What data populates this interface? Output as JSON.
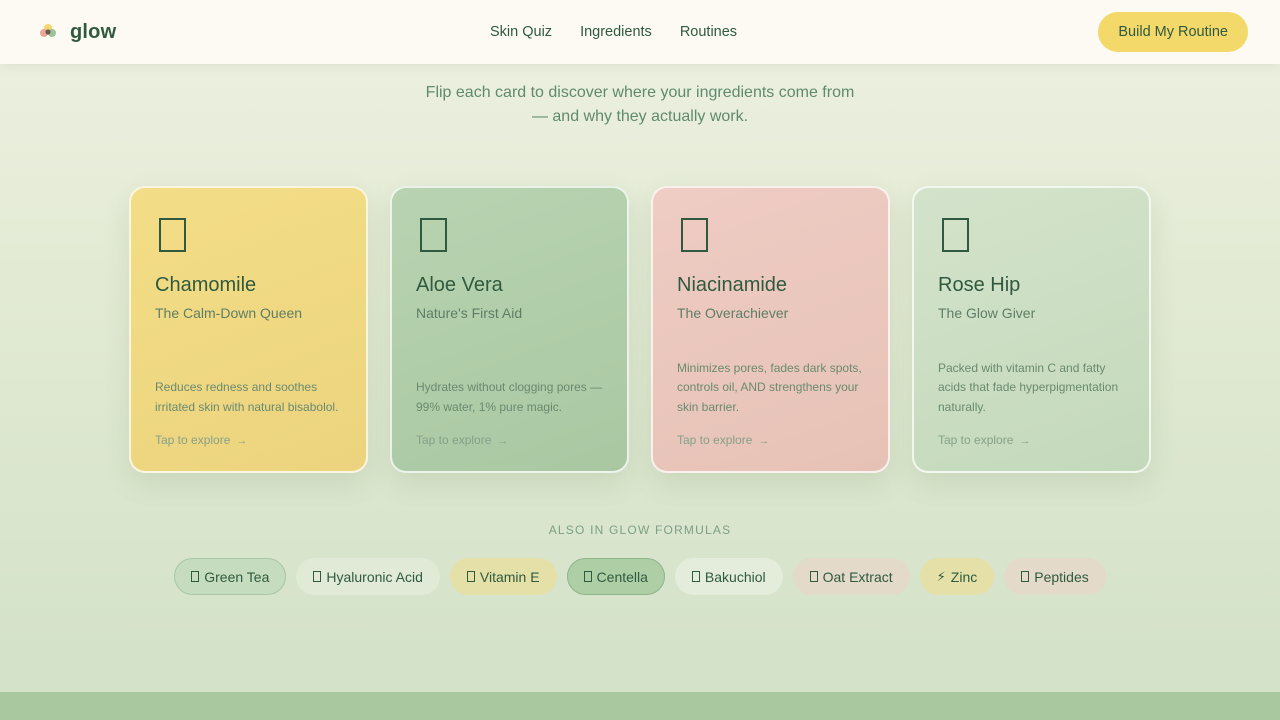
{
  "header": {
    "brand": "glow",
    "nav": [
      "Skin Quiz",
      "Ingredients",
      "Routines"
    ],
    "cta_label": "Build My Routine"
  },
  "intro": {
    "line1": "Flip each card to discover where your ingredients come from",
    "line2": "— and why they actually work."
  },
  "cards": [
    {
      "title": "Chamomile",
      "subtitle": "The Calm-Down Queen",
      "description": "Reduces redness and soothes irritated skin with natural bisabolol.",
      "tap": "Tap to explore",
      "color": "#f3dd86"
    },
    {
      "title": "Aloe Vera",
      "subtitle": "Nature's First Aid",
      "description": "Hydrates without clogging pores — 99% water, 1% pure magic.",
      "tap": "Tap to explore",
      "color": "#b8d3b1"
    },
    {
      "title": "Niacinamide",
      "subtitle": "The Overachiever",
      "description": "Minimizes pores, fades dark spots, controls oil, AND strengthens your skin barrier.",
      "tap": "Tap to explore",
      "color": "#efccc4"
    },
    {
      "title": "Rose Hip",
      "subtitle": "The Glow Giver",
      "description": "Packed with vitamin C and fatty acids that fade hyperpigmentation naturally.",
      "tap": "Tap to explore",
      "color": "#d3e3cb"
    }
  ],
  "also": {
    "heading": "ALSO IN GLOW FORMULAS",
    "chips": [
      {
        "label": "Green Tea",
        "icon": "leaf-icon"
      },
      {
        "label": "Hyaluronic Acid",
        "icon": "droplet-icon"
      },
      {
        "label": "Vitamin E",
        "icon": "capsule-icon"
      },
      {
        "label": "Centella",
        "icon": "herb-icon",
        "selected": true
      },
      {
        "label": "Bakuchiol",
        "icon": "plant-icon"
      },
      {
        "label": "Oat Extract",
        "icon": "grain-icon"
      },
      {
        "label": "Zinc",
        "icon": "lightning-icon"
      },
      {
        "label": "Peptides",
        "icon": "molecule-icon"
      }
    ]
  }
}
